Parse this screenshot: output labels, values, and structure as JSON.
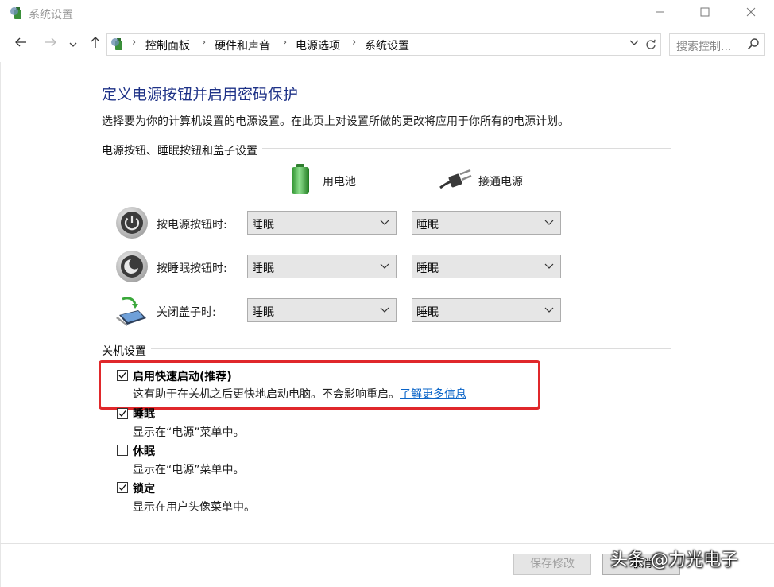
{
  "window": {
    "title": "系统设置"
  },
  "breadcrumb": [
    "控制面板",
    "硬件和声音",
    "电源选项",
    "系统设置"
  ],
  "search": {
    "placeholder": "搜索控制..."
  },
  "page": {
    "heading": "定义电源按钮并启用密码保护",
    "description": "选择要为你的计算机设置的电源设置。在此页上对设置所做的更改将应用于你所有的电源计划。"
  },
  "power_section": {
    "label": "电源按钮、睡眠按钮和盖子设置",
    "columns": {
      "battery": "用电池",
      "plugged": "接通电源"
    },
    "rows": [
      {
        "label": "按电源按钮时:",
        "battery": "睡眠",
        "plugged": "睡眠"
      },
      {
        "label": "按睡眠按钮时:",
        "battery": "睡眠",
        "plugged": "睡眠"
      },
      {
        "label": "关闭盖子时:",
        "battery": "睡眠",
        "plugged": "睡眠"
      }
    ]
  },
  "shutdown_section": {
    "label": "关机设置",
    "options": [
      {
        "title": "启用快速启动(推荐)",
        "desc": "这有助于在关机之后更快地启动电脑。不会影响重启。",
        "link": "了解更多信息",
        "checked": true
      },
      {
        "title": "睡眠",
        "desc": "显示在“电源”菜单中。",
        "checked": true
      },
      {
        "title": "休眠",
        "desc": "显示在“电源”菜单中。",
        "checked": false
      },
      {
        "title": "锁定",
        "desc": "显示在用户头像菜单中。",
        "checked": true
      }
    ]
  },
  "footer": {
    "save_label": "保存修改",
    "cancel_label": "取消"
  },
  "watermark": "头条 @力光电子",
  "colors": {
    "heading": "#1e3287",
    "link": "#0a64c8",
    "highlight": "#e0282b"
  }
}
